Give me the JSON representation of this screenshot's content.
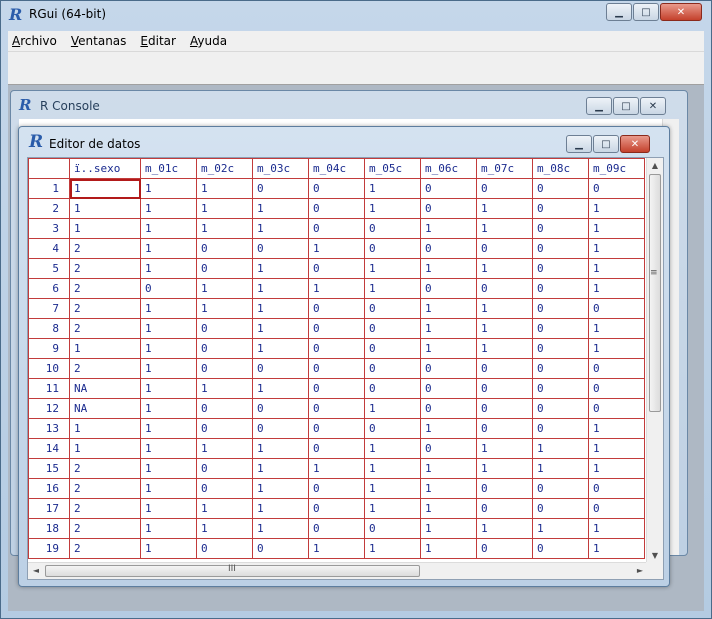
{
  "main_window": {
    "title": "RGui (64-bit)",
    "minimize_glyph": "▁",
    "maximize_glyph": "□",
    "close_glyph": "✕"
  },
  "menu": {
    "items": [
      {
        "first": "A",
        "rest": "rchivo"
      },
      {
        "first": "V",
        "rest": "entanas"
      },
      {
        "first": "E",
        "rest": "ditar"
      },
      {
        "first": "A",
        "rest": "yuda"
      }
    ]
  },
  "console": {
    "title": "R Console"
  },
  "editor": {
    "title": "Editor de datos",
    "columns": [
      "ï..sexo",
      "m_01c",
      "m_02c",
      "m_03c",
      "m_04c",
      "m_05c",
      "m_06c",
      "m_07c",
      "m_08c",
      "m_09c"
    ],
    "rows": [
      {
        "n": "1",
        "cells": [
          "1",
          "1",
          "1",
          "0",
          "0",
          "1",
          "0",
          "0",
          "0",
          "0"
        ]
      },
      {
        "n": "2",
        "cells": [
          "1",
          "1",
          "1",
          "1",
          "0",
          "1",
          "0",
          "1",
          "0",
          "1"
        ]
      },
      {
        "n": "3",
        "cells": [
          "1",
          "1",
          "1",
          "1",
          "0",
          "0",
          "1",
          "1",
          "0",
          "1"
        ]
      },
      {
        "n": "4",
        "cells": [
          "2",
          "1",
          "0",
          "0",
          "1",
          "0",
          "0",
          "0",
          "0",
          "1"
        ]
      },
      {
        "n": "5",
        "cells": [
          "2",
          "1",
          "0",
          "1",
          "0",
          "1",
          "1",
          "1",
          "0",
          "1"
        ]
      },
      {
        "n": "6",
        "cells": [
          "2",
          "0",
          "1",
          "1",
          "1",
          "1",
          "0",
          "0",
          "0",
          "1"
        ]
      },
      {
        "n": "7",
        "cells": [
          "2",
          "1",
          "1",
          "1",
          "0",
          "0",
          "1",
          "1",
          "0",
          "0"
        ]
      },
      {
        "n": "8",
        "cells": [
          "2",
          "1",
          "0",
          "1",
          "0",
          "0",
          "1",
          "1",
          "0",
          "1"
        ]
      },
      {
        "n": "9",
        "cells": [
          "1",
          "1",
          "0",
          "1",
          "0",
          "0",
          "1",
          "1",
          "0",
          "1"
        ]
      },
      {
        "n": "10",
        "cells": [
          "2",
          "1",
          "0",
          "0",
          "0",
          "0",
          "0",
          "0",
          "0",
          "0"
        ]
      },
      {
        "n": "11",
        "cells": [
          "NA",
          "1",
          "1",
          "1",
          "0",
          "0",
          "0",
          "0",
          "0",
          "0"
        ]
      },
      {
        "n": "12",
        "cells": [
          "NA",
          "1",
          "0",
          "0",
          "0",
          "1",
          "0",
          "0",
          "0",
          "0"
        ]
      },
      {
        "n": "13",
        "cells": [
          "1",
          "1",
          "0",
          "0",
          "0",
          "0",
          "1",
          "0",
          "0",
          "1"
        ]
      },
      {
        "n": "14",
        "cells": [
          "1",
          "1",
          "1",
          "1",
          "0",
          "1",
          "0",
          "1",
          "1",
          "1"
        ]
      },
      {
        "n": "15",
        "cells": [
          "2",
          "1",
          "0",
          "1",
          "1",
          "1",
          "1",
          "1",
          "1",
          "1"
        ]
      },
      {
        "n": "16",
        "cells": [
          "2",
          "1",
          "0",
          "1",
          "0",
          "1",
          "1",
          "0",
          "0",
          "0"
        ]
      },
      {
        "n": "17",
        "cells": [
          "2",
          "1",
          "1",
          "1",
          "0",
          "1",
          "1",
          "0",
          "0",
          "0"
        ]
      },
      {
        "n": "18",
        "cells": [
          "2",
          "1",
          "1",
          "1",
          "0",
          "0",
          "1",
          "1",
          "1",
          "1"
        ]
      },
      {
        "n": "19",
        "cells": [
          "2",
          "1",
          "0",
          "0",
          "1",
          "1",
          "1",
          "0",
          "0",
          "1"
        ]
      }
    ],
    "active_cell": {
      "row": 1,
      "column": "ï..sexo"
    }
  },
  "scrollbars": {
    "up": "▲",
    "down": "▼",
    "left": "◄",
    "right": "►",
    "grip_v": "≡",
    "grip_h": "III"
  },
  "colors": {
    "grid_border": "#c23b3b",
    "cell_text": "#1b2b8f",
    "r_logo": "#2a5caa"
  }
}
